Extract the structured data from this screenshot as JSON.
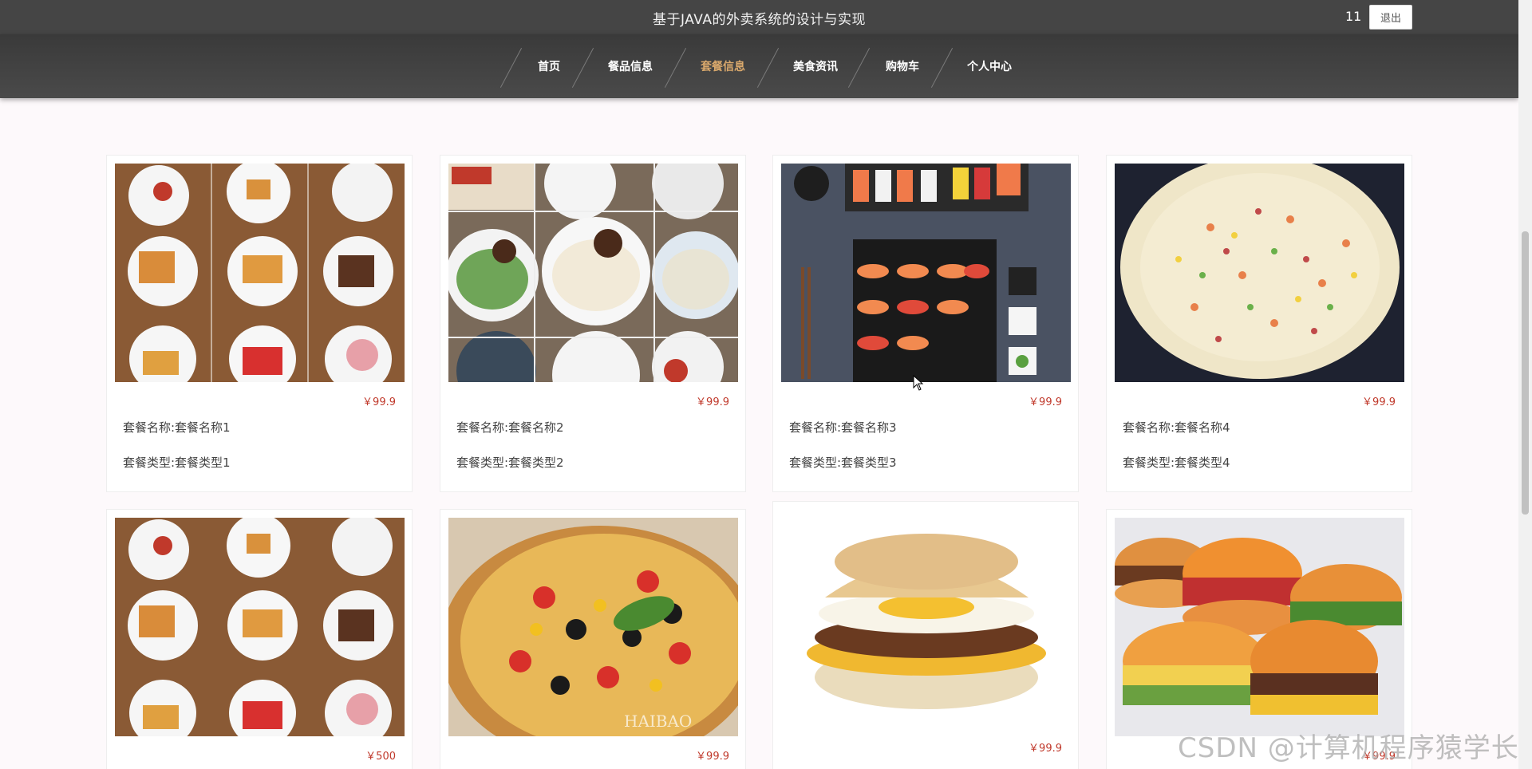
{
  "header": {
    "site_title": "基于JAVA的外卖系统的设计与实现",
    "user_count": "11",
    "logout_label": "退出"
  },
  "nav": {
    "items": [
      {
        "label": "首页"
      },
      {
        "label": "餐品信息"
      },
      {
        "label": "套餐信息",
        "active": true
      },
      {
        "label": "美食资讯"
      },
      {
        "label": "购物车"
      },
      {
        "label": "个人中心"
      }
    ]
  },
  "cards": [
    {
      "price": "￥99.9",
      "name": "套餐名称:套餐名称1",
      "type": "套餐类型:套餐类型1",
      "image": "waffle-breakfast-grid"
    },
    {
      "price": "￥99.9",
      "name": "套餐名称:套餐名称2",
      "type": "套餐类型:套餐类型2",
      "image": "dumplings-grid"
    },
    {
      "price": "￥99.9",
      "name": "套餐名称:套餐名称3",
      "type": "套餐类型:套餐类型3",
      "image": "sushi-platter"
    },
    {
      "price": "￥99.9",
      "name": "套餐名称:套餐名称4",
      "type": "套餐类型:套餐类型4",
      "image": "fried-rice"
    },
    {
      "price": "￥500",
      "image": "waffle-breakfast-grid"
    },
    {
      "price": "￥99.9",
      "image": "pizza",
      "image_text": "HAIBAO"
    },
    {
      "price": "￥99.9",
      "image": "egg-muffin-sandwich"
    },
    {
      "price": "￥99.9",
      "image": "burgers"
    }
  ],
  "watermark": "CSDN @计算机程序猿学长",
  "colors": {
    "topbar": "#454545",
    "nav_active": "#d9a86c",
    "price": "#c0392b"
  }
}
